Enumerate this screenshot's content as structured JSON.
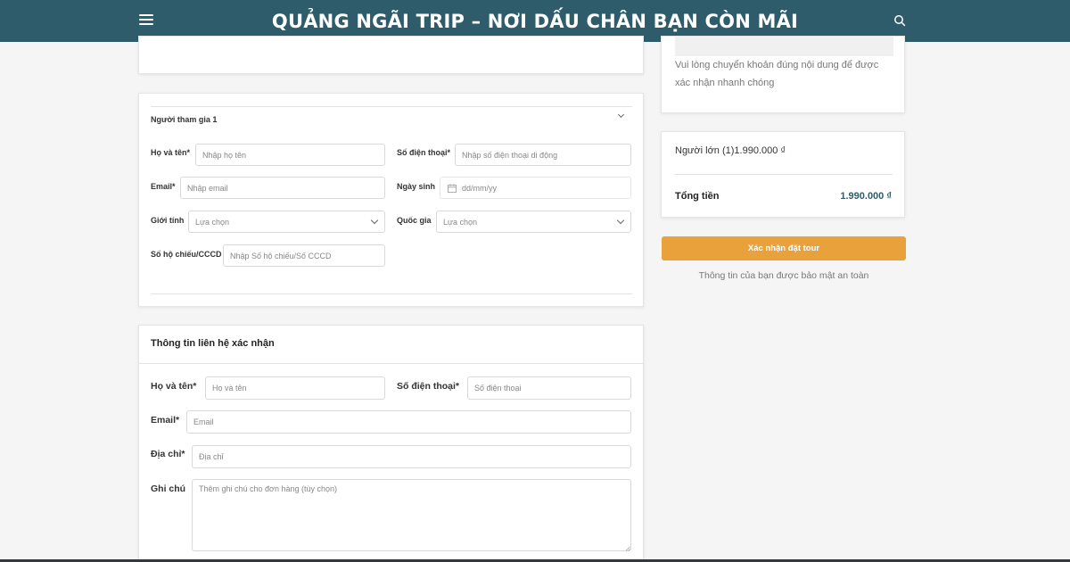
{
  "header": {
    "title": "QUẢNG NGÃI TRIP – NƠI DẤU CHÂN BẠN CÒN MÃI",
    "menu_icon": "hamburger-menu-icon",
    "search_icon": "search-icon",
    "background_color": "#2f5c6b"
  },
  "transfer_note": "Vui lòng chuyển khoản đúng nội dung để được xác nhận nhanh chóng",
  "participant": {
    "section_title": "Người tham gia 1",
    "fullname_label": "Họ và tên*",
    "fullname_placeholder": "Nhập họ tên",
    "phone_label": "Số điện thoại*",
    "phone_placeholder": "Nhập số điện thoại di động",
    "email_label": "Email*",
    "email_placeholder": "Nhập email",
    "dob_label": "Ngày sinh",
    "dob_placeholder": "dd/mm/yy",
    "gender_label": "Giới tính",
    "gender_value": "Lựa chọn",
    "country_label": "Quốc gia",
    "country_value": "Lựa chọn",
    "passport_label": "Số hộ chiếu/CCCD",
    "passport_placeholder": "Nhập Số hộ chiếu/Số CCCD"
  },
  "contact": {
    "section_title": "Thông tin liên hệ xác nhận",
    "fullname_label": "Họ và tên*",
    "fullname_placeholder": "Họ và tên",
    "phone_label": "Số điện thoại*",
    "phone_placeholder": "Số điện thoại",
    "email_label": "Email*",
    "email_placeholder": "Email",
    "address_label": "Địa chỉ*",
    "address_placeholder": "Địa chỉ",
    "note_label": "Ghi chú",
    "note_placeholder": "Thêm ghi chú cho đơn hàng (tùy chọn)"
  },
  "summary": {
    "adult_line": "Người lớn (1)1.990.000 ₫",
    "total_label": "Tổng tiền",
    "total_value": "1.990.000 ₫",
    "total_color": "#2f5c6b"
  },
  "confirm_button": {
    "label": "Xác nhận đặt tour",
    "color": "#e9a23b"
  },
  "secure_note": "Thông tin của bạn được bảo mật an toàn"
}
